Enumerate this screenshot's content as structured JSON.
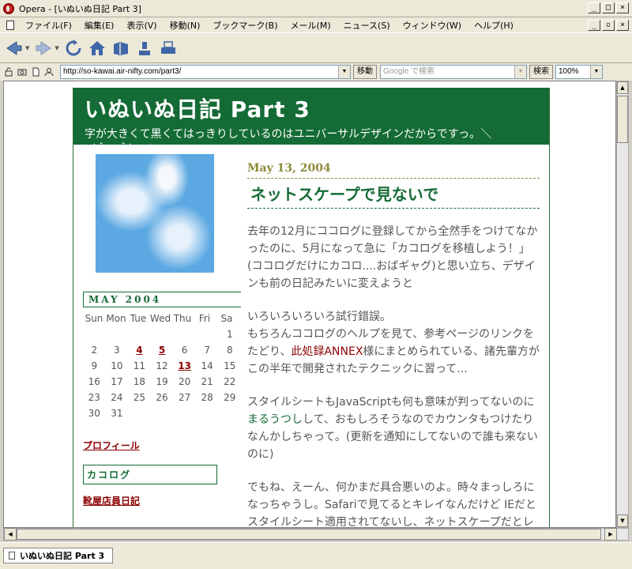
{
  "window": {
    "title": "Opera - [いぬいぬ日記 Part 3]"
  },
  "menu": {
    "items": [
      "ファイル(F)",
      "編集(E)",
      "表示(V)",
      "移動(N)",
      "ブックマーク(B)",
      "メール(M)",
      "ニュース(S)",
      "ウィンドウ(W)",
      "ヘルプ(H)"
    ]
  },
  "address": {
    "url": "http://so-kawai.air-nifty.com/part3/",
    "go_label": "移動",
    "search_placeholder": "Google で検索",
    "search_label": "検索",
    "zoom": "100%"
  },
  "blog": {
    "title": "いぬいぬ日記 Part 3",
    "description": "字が大きくて黒くてはっきりしているのはユニバーサルデザインだからですっ。＼",
    "description2": "（＾＿＾）／"
  },
  "calendar": {
    "month": "MAY 2004",
    "days_of_week": [
      "Sun",
      "Mon",
      "Tue",
      "Wed",
      "Thu",
      "Fri",
      "Sa"
    ],
    "weeks": [
      [
        "",
        "",
        "",
        "",
        "",
        "",
        "1"
      ],
      [
        "2",
        "3",
        "4",
        "5",
        "6",
        "7",
        "8"
      ],
      [
        "9",
        "10",
        "11",
        "12",
        "13",
        "14",
        "15"
      ],
      [
        "16",
        "17",
        "18",
        "19",
        "20",
        "21",
        "22"
      ],
      [
        "23",
        "24",
        "25",
        "26",
        "27",
        "28",
        "29"
      ],
      [
        "30",
        "31",
        "",
        "",
        "",
        "",
        ""
      ]
    ],
    "linked_days": [
      "4",
      "5",
      "13"
    ]
  },
  "sidebar": {
    "profile_label": "プロフィール",
    "cocolog_label": "カコログ",
    "shoes_label": "靴屋店員日記"
  },
  "post": {
    "date": "May 13, 2004",
    "title": "ネットスケープで見ないで",
    "p1": "去年の12月にココログに登録してから全然手をつけてなかったのに、5月になって急に「カコログを移植しよう！」(ココログだけにカコロ....おばギャグ)と思い立ち、デザインも前の日記みたいに変えようと",
    "p2a": "いろいろいろいろ試行錯誤。",
    "p2b": "もちろんココログのヘルプを見て、参考ページのリンクをたどり、",
    "p2_link": "此処録ANNEX",
    "p2c": "様にまとめられている、諸先輩方がこの半年で開発されたテクニックに習って...",
    "p3a": "スタイルシートもJavaScriptも何も意味が判ってないのに",
    "p3_link": "まるうつし",
    "p3b": "して、おもしろそうなのでカウンタもつけたりなんかしちゃって。(更新を通知にしてないので誰も来ないのに)",
    "p4": "でもね、えーん、何かまだ具合悪いのよ。時々まっしろになっちゃうし。Safariで見てるとキレイなんだけど IEだとスタイルシート適用されてないし、ネットスケープだとレイ"
  },
  "status": {
    "tab_label": "いぬいぬ日記 Part 3"
  }
}
